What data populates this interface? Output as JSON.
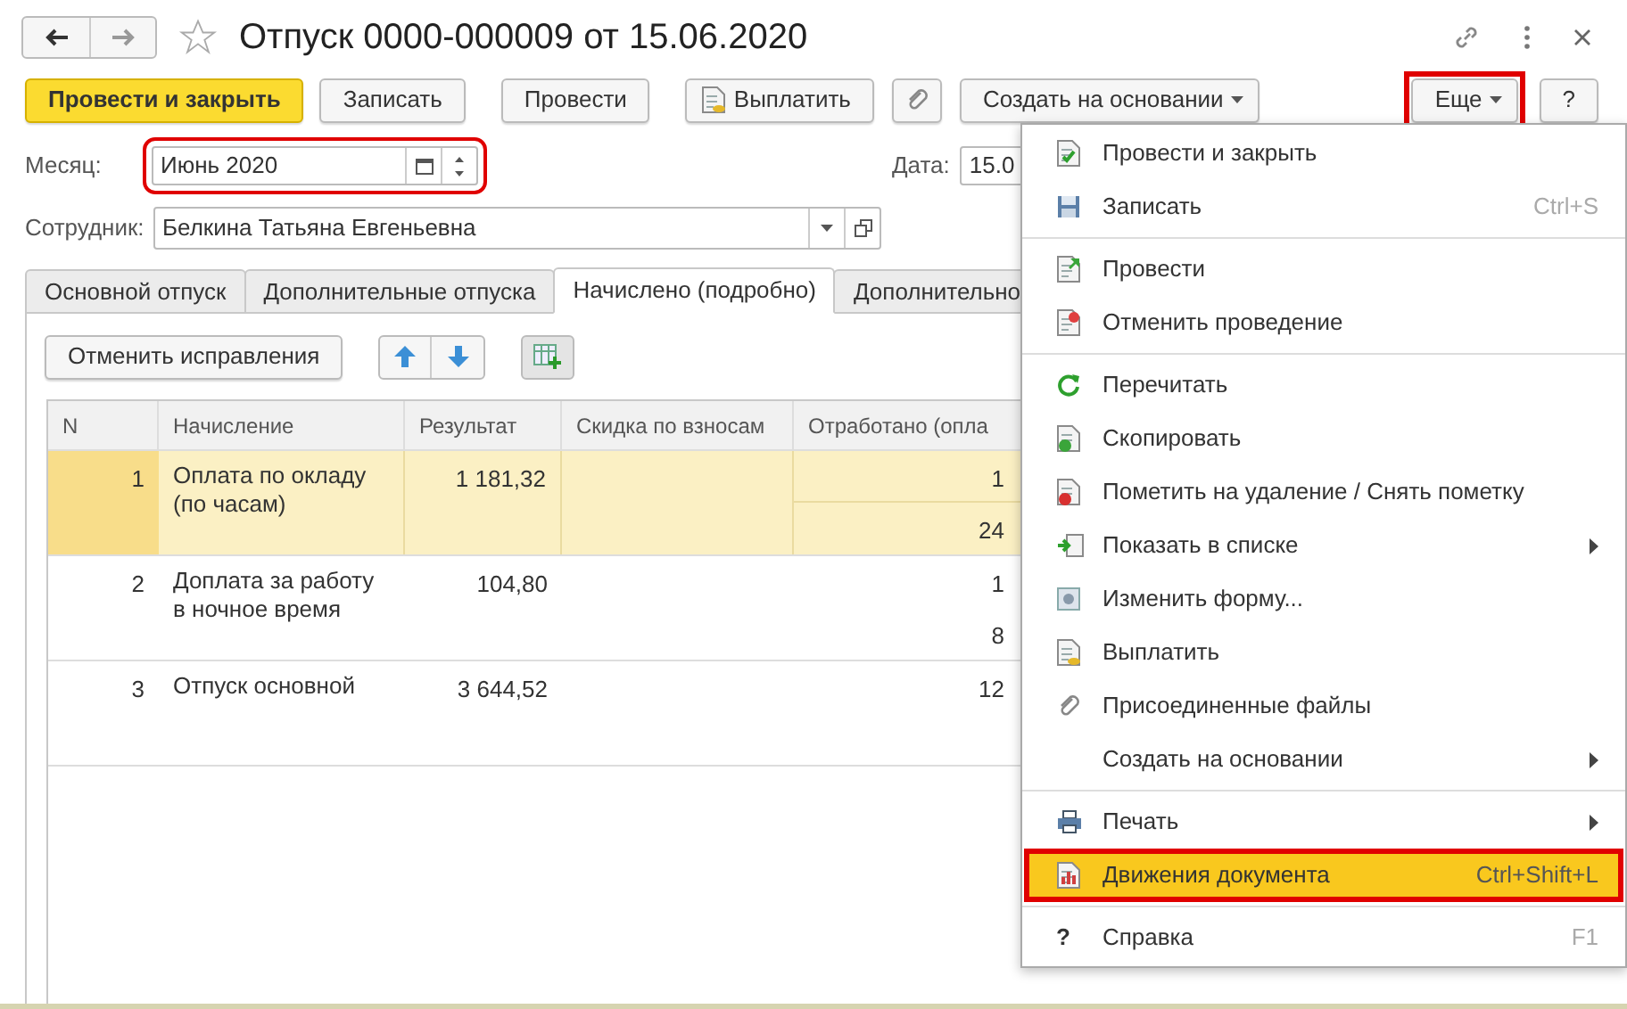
{
  "window": {
    "title": "Отпуск 0000-000009 от 15.06.2020",
    "favorite": false
  },
  "toolbar": {
    "buttons": [
      {
        "kind": "primary",
        "label": "Провести и закрыть",
        "highlighted": false
      },
      {
        "kind": "plain",
        "label": "Записать",
        "highlighted": false
      },
      {
        "kind": "plain",
        "label": "Провести",
        "highlighted": false
      },
      {
        "kind": "icon-text",
        "label": "Выплатить",
        "highlighted": false
      },
      {
        "kind": "clip",
        "highlighted": false
      },
      {
        "kind": "dropdown",
        "label": "Создать на основании",
        "highlighted": false
      },
      {
        "kind": "dropdown",
        "label": "Еще",
        "highlighted": true
      },
      {
        "kind": "plain",
        "label": "?",
        "highlighted": false
      }
    ]
  },
  "month": {
    "label": "Месяц:",
    "value": "Июнь 2020",
    "highlighted": true
  },
  "date": {
    "label": "Дата:",
    "value": "15.0"
  },
  "employee": {
    "label": "Сотрудник:",
    "value": "Белкина Татьяна Евгеньевна"
  },
  "tabs": [
    {
      "label": "Основной отпуск",
      "selected": false
    },
    {
      "label": "Дополнительные отпуска",
      "selected": false
    },
    {
      "label": "Начислено (подробно)",
      "selected": true
    },
    {
      "label": "Дополнительно",
      "selected": false
    }
  ],
  "panel_toolbar": {
    "cancel_button": "Отменить исправления"
  },
  "table": {
    "columns": [
      "N",
      "Начисление",
      "Результат",
      "Скидка по взносам",
      "Отработано (опла"
    ],
    "rows": [
      {
        "n": "1",
        "accrual": "Оплата по окладу (по часам)",
        "result": "1 181,32",
        "worked": [
          "1",
          "24"
        ],
        "selected": true
      },
      {
        "n": "2",
        "accrual": "Доплата за работу в ночное время",
        "result": "104,80",
        "worked": [
          "1",
          "8"
        ],
        "selected": false
      },
      {
        "n": "3",
        "accrual": "Отпуск основной",
        "result": "3 644,52",
        "worked": [
          "12"
        ],
        "selected": false
      }
    ]
  },
  "menu": {
    "sections": [
      [
        {
          "label": "Провести и закрыть",
          "submenu": false,
          "selected": false,
          "highlighted": false
        },
        {
          "label": "Записать",
          "shortcut": "Ctrl+S",
          "submenu": false,
          "selected": false,
          "highlighted": false
        }
      ],
      [
        {
          "label": "Провести",
          "submenu": false,
          "selected": false,
          "highlighted": false
        },
        {
          "label": "Отменить проведение",
          "submenu": false,
          "selected": false,
          "highlighted": false
        }
      ],
      [
        {
          "label": "Перечитать",
          "submenu": false,
          "selected": false,
          "highlighted": false
        },
        {
          "label": "Скопировать",
          "submenu": false,
          "selected": false,
          "highlighted": false
        },
        {
          "label": "Пометить на удаление / Снять пометку",
          "submenu": false,
          "selected": false,
          "highlighted": false
        },
        {
          "label": "Показать в списке",
          "submenu": true,
          "selected": false,
          "highlighted": false
        },
        {
          "label": "Изменить форму...",
          "submenu": false,
          "selected": false,
          "highlighted": false
        },
        {
          "label": "Выплатить",
          "submenu": false,
          "selected": false,
          "highlighted": false
        },
        {
          "label": "Присоединенные файлы",
          "submenu": false,
          "selected": false,
          "highlighted": false
        },
        {
          "label": "Создать на основании",
          "submenu": true,
          "selected": false,
          "highlighted": false
        }
      ],
      [
        {
          "label": "Печать",
          "submenu": true,
          "selected": false,
          "highlighted": false
        },
        {
          "label": "Движения документа",
          "shortcut": "Ctrl+Shift+L",
          "submenu": false,
          "selected": true,
          "highlighted": true
        }
      ],
      [
        {
          "label": "Справка",
          "icon_char": "?",
          "shortcut": "F1",
          "submenu": false,
          "selected": false,
          "highlighted": false
        }
      ]
    ]
  }
}
